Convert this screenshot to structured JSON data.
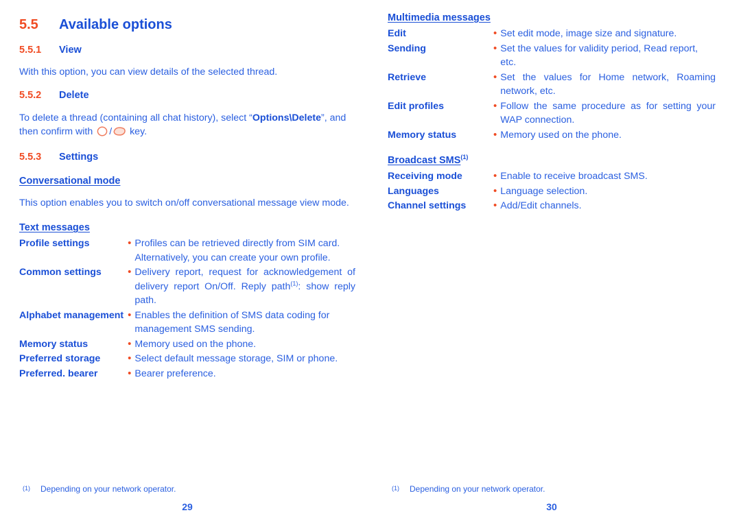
{
  "document": {
    "colors": {
      "blue": "#1a4fd6",
      "body_blue": "#2a5fe0",
      "orange": "#f04b23"
    }
  },
  "left_column": {
    "section": {
      "number": "5.5",
      "title": "Available options"
    },
    "subsections": [
      {
        "number": "5.5.1",
        "title": "View",
        "body": "With this option, you can view details of the selected thread."
      },
      {
        "number": "5.5.2",
        "title": "Delete",
        "body_part1": "To delete a thread (containing all chat history), select “",
        "body_bold": "Options\\Delete",
        "body_part2": "”",
        "body_part3": ", and then confirm with ",
        "body_part4": " key.",
        "key_icon_1": "hexagon-key-icon",
        "key_separator": "/",
        "key_icon_2": "back-key-icon"
      },
      {
        "number": "5.5.3",
        "title": "Settings"
      }
    ],
    "conversational_mode": {
      "heading": "Conversational mode",
      "body": "This option enables you to switch on/off conversational message view mode."
    },
    "text_messages": {
      "heading": "Text messages",
      "rows": [
        {
          "term": "Profile settings",
          "definition": "Profiles can be retrieved directly from SIM card. Alternatively, you can create your own profile.",
          "justified": false
        },
        {
          "term": "Common settings",
          "def_part1": "Delivery report, request for acknowledgement of delivery report On/Off. Reply path",
          "footnote_mark": "(1)",
          "def_part2": ": show reply path.",
          "justified": true
        },
        {
          "term": "Alphabet management",
          "definition": "Enables the definition of SMS data coding for management SMS sending.",
          "justified": false
        },
        {
          "term": "Memory status",
          "definition": "Memory used on the phone.",
          "justified": false
        },
        {
          "term": "Preferred storage",
          "definition": "Select default message storage, SIM or phone.",
          "justified": false
        },
        {
          "term": "Preferred. bearer",
          "definition": "Bearer preference.",
          "justified": false
        }
      ]
    },
    "footnote": {
      "mark": "(1)",
      "text": "Depending on your network operator."
    },
    "page_number": "29"
  },
  "right_column": {
    "multimedia_messages": {
      "heading": "Multimedia messages",
      "rows": [
        {
          "term": "Edit",
          "definition": "Set edit mode, image size and signature.",
          "justified": false
        },
        {
          "term": "Sending",
          "definition": "Set the values for validity period, Read report, etc.",
          "justified": false
        },
        {
          "term": "Retrieve",
          "definition": "Set the values for Home network, Roaming network, etc.",
          "justified": true
        },
        {
          "term": "Edit profiles",
          "definition": "Follow the same procedure as for setting your WAP connection.",
          "justified": true
        },
        {
          "term": "Memory status",
          "definition": "Memory used on the phone.",
          "justified": false
        }
      ]
    },
    "broadcast_sms": {
      "heading": "Broadcast SMS",
      "footnote_mark": "(1)",
      "rows": [
        {
          "term": "Receiving mode",
          "definition": "Enable to receive broadcast SMS.",
          "justified": false
        },
        {
          "term": "Languages",
          "definition": "Language selection.",
          "justified": false
        },
        {
          "term": "Channel settings",
          "definition": "Add/Edit channels.",
          "justified": false
        }
      ]
    },
    "footnote": {
      "mark": "(1)",
      "text": "Depending on your network operator."
    },
    "page_number": "30"
  }
}
